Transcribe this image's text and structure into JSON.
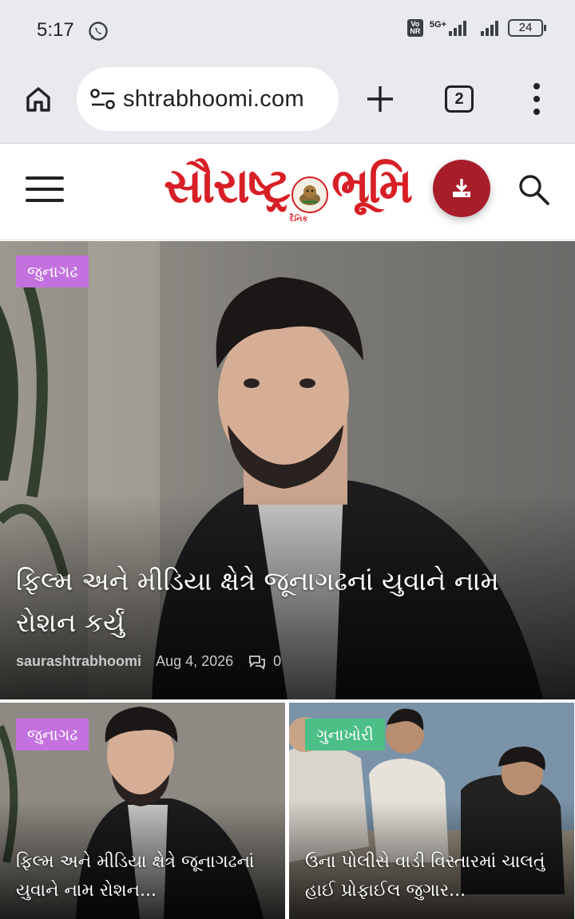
{
  "status_bar": {
    "time": "5:17",
    "network_label": "5G+",
    "volte_label": "Vo NR",
    "battery": "24"
  },
  "browser": {
    "url": "shtrabhoomi.com",
    "tab_count": "2"
  },
  "site": {
    "logo_left": "સૌરાષ્ટ્ર",
    "logo_right": "ભૂમિ",
    "logo_small": "દૈનિક"
  },
  "hero": {
    "tag": "જુનાગઢ",
    "title": "ફિલ્મ અને મીડિયા ક્ષેત્રે જૂનાગઢનાં યુવાને નામ રોશન કર્યું",
    "author": "saurashtrabhoomi",
    "date": "Aug 4, 2026",
    "comments": "0"
  },
  "cards": [
    {
      "tag": "જુનાગઢ",
      "title": "ફિલ્મ અને મીડિયા ક્ષેત્રે જૂનાગઢનાં યુવાને નામ રોશન..."
    },
    {
      "tag": "ગુનાખોરી",
      "title": "ઉના પોલીસે વાડી વિસ્તારમાં ચાલતું હાઈ પ્રોફાઈલ જુગાર..."
    }
  ],
  "colors": {
    "brand_red": "#d81f26",
    "download_button": "#a71d2a",
    "tag_purple": "#c471e0",
    "tag_green": "#4bbf86"
  }
}
